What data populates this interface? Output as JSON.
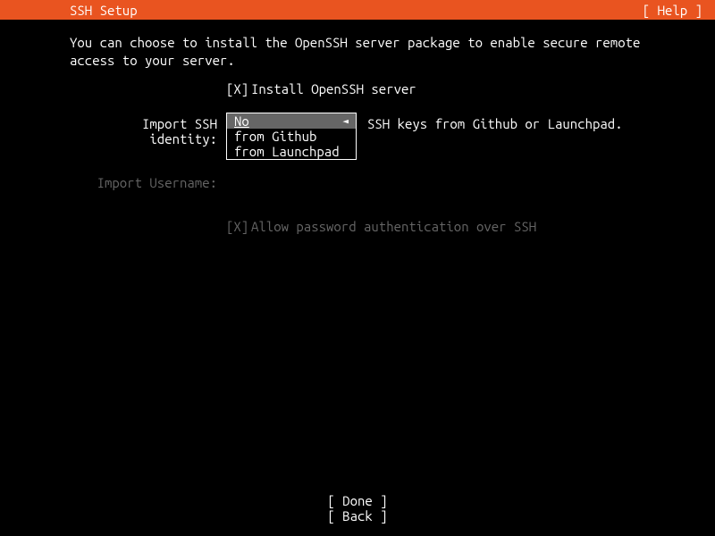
{
  "header": {
    "title": "SSH Setup",
    "help": "[ Help ]"
  },
  "description": "You can choose to install the OpenSSH server package to enable secure remote access to your server.",
  "install_openssh": {
    "mark": "[X]",
    "label": "Install OpenSSH server"
  },
  "import_identity": {
    "label": "Import SSH identity:",
    "selected_text": "No",
    "option_github": "from Github",
    "option_launchpad": "from Launchpad",
    "arrow": "◄",
    "trailing": "SSH keys from Github or Launchpad."
  },
  "import_username": {
    "label": "Import Username:"
  },
  "allow_password": {
    "mark": "[X]",
    "label": "Allow password authentication over SSH"
  },
  "buttons": {
    "done": "[ Done       ]",
    "back": "[ Back       ]"
  }
}
